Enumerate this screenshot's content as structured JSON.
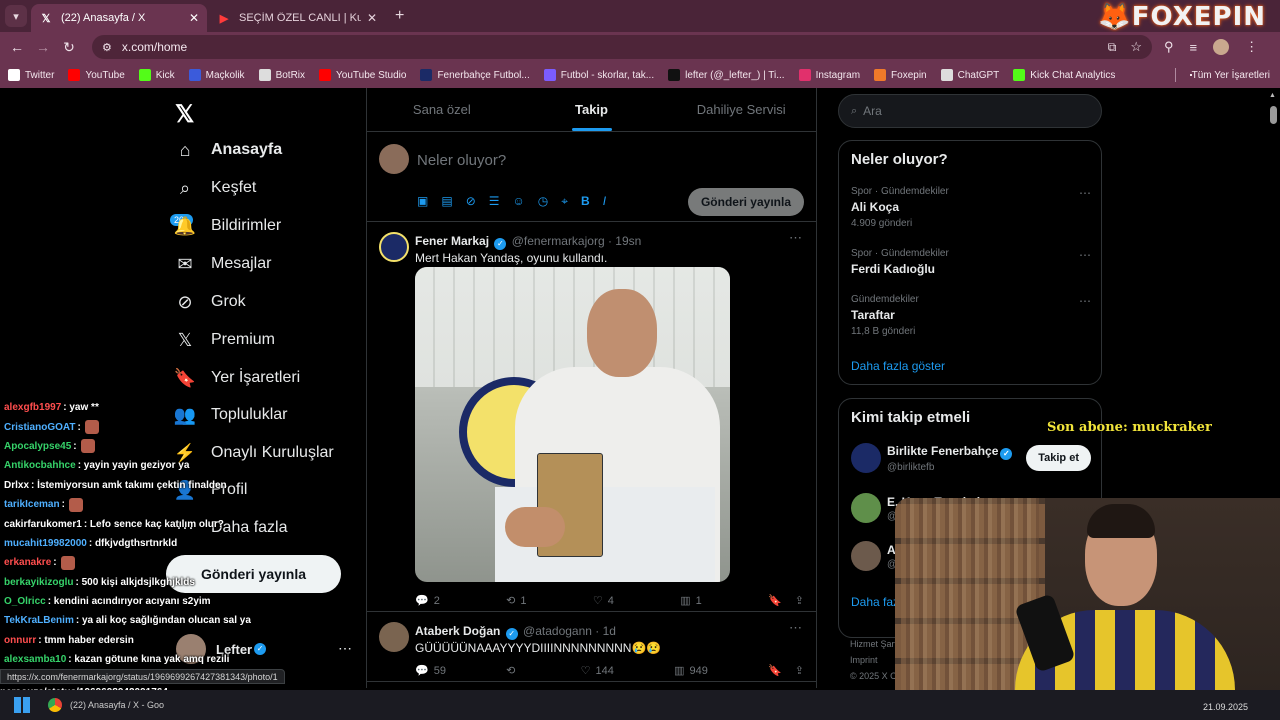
{
  "browser": {
    "tabs": [
      {
        "title": "(22) Anasayfa / X",
        "icon": "x-logo-icon"
      },
      {
        "title": "SEÇİM ÖZEL CANLI | Kulübü",
        "icon": "youtube-icon"
      }
    ],
    "url": "x.com/home",
    "brand": "FOXEPIN",
    "bookmarks": [
      {
        "label": "Twitter",
        "icon": "x-logo-icon",
        "color": "#ffffff"
      },
      {
        "label": "YouTube",
        "icon": "youtube-icon",
        "color": "#ff0000"
      },
      {
        "label": "Kick",
        "icon": "kick-icon",
        "color": "#53fc18"
      },
      {
        "label": "Maçkolik",
        "icon": "mackolik-icon",
        "color": "#3b5bdb"
      },
      {
        "label": "BotRix",
        "icon": "botrix-icon",
        "color": "#dddddd"
      },
      {
        "label": "YouTube Studio",
        "icon": "youtube-studio-icon",
        "color": "#ff0000"
      },
      {
        "label": "Fenerbahçe Futbol...",
        "icon": "fenerbahce-icon",
        "color": "#1b2a66"
      },
      {
        "label": "Futbol - skorlar, tak...",
        "icon": "futbol-icon",
        "color": "#7b5cff"
      },
      {
        "label": "lefter (@_lefter_) | Ti...",
        "icon": "tiktok-icon",
        "color": "#111111"
      },
      {
        "label": "Instagram",
        "icon": "instagram-icon",
        "color": "#e1306c"
      },
      {
        "label": "Foxepin",
        "icon": "foxepin-icon",
        "color": "#f07a2a"
      },
      {
        "label": "ChatGPT",
        "icon": "chatgpt-icon",
        "color": "#dddddd"
      },
      {
        "label": "Kick Chat Analytics",
        "icon": "kick-chat-icon",
        "color": "#53fc18"
      }
    ],
    "all_bookmarks": "Tüm Yer İşaretleri",
    "status_url": "https://x.com/fenermarkajorg/status/1969699267427381343/photo/1"
  },
  "x": {
    "nav": [
      {
        "label": "Anasayfa",
        "icon": "home-icon",
        "glyph": "⌂"
      },
      {
        "label": "Keşfet",
        "icon": "search-icon",
        "glyph": "⌕"
      },
      {
        "label": "Bildirimler",
        "icon": "bell-icon",
        "glyph": "🔔"
      },
      {
        "label": "Mesajlar",
        "icon": "mail-icon",
        "glyph": "✉"
      },
      {
        "label": "Grok",
        "icon": "grok-icon",
        "glyph": "⊘"
      },
      {
        "label": "Premium",
        "icon": "x-premium-icon",
        "glyph": "𝕏"
      },
      {
        "label": "Yer İşaretleri",
        "icon": "bookmark-icon",
        "glyph": "🔖"
      },
      {
        "label": "Topluluklar",
        "icon": "communities-icon",
        "glyph": "👥"
      },
      {
        "label": "Onaylı Kuruluşlar",
        "icon": "lightning-icon",
        "glyph": "⚡"
      },
      {
        "label": "Profil",
        "icon": "profile-icon",
        "glyph": "👤"
      },
      {
        "label": "Daha fazla",
        "icon": "more-icon",
        "glyph": "⋯"
      }
    ],
    "notif_badge": "20+",
    "post_button": "Gönderi yayınla",
    "profile_name": "Lefter",
    "feed_tabs": [
      "Sana özel",
      "Takip",
      "Dahiliye Servisi"
    ],
    "composer": {
      "placeholder": "Neler oluyor?",
      "post_button": "Gönderi yayınla"
    },
    "tweets": [
      {
        "name": "Fener Markaj",
        "handle": "@fenermarkajorg",
        "time": "· 19sn",
        "text": "Mert Hakan Yandaş, oyunu kullandı.",
        "replies": "2",
        "reposts": "1",
        "likes": "4",
        "views": "1"
      },
      {
        "name": "Ataberk Doğan",
        "handle": "@atadogann",
        "time": "· 1d",
        "text": "GÜÜÜÜÜNAAAYYYYDIIIINNNNNNNNN😢😢",
        "replies": "59",
        "reposts": "",
        "likes": "144",
        "views": "949"
      }
    ],
    "search_placeholder": "Ara",
    "trends_title": "Neler oluyor?",
    "trends": [
      {
        "category": "Spor · Gündemdekiler",
        "name": "Ali Koça",
        "count": "4.909 gönderi"
      },
      {
        "category": "Spor · Gündemdekiler",
        "name": "Ferdi Kadıoğlu",
        "count": ""
      },
      {
        "category": "Gündemdekiler",
        "name": "Taraftar",
        "count": "11,8 B gönderi"
      }
    ],
    "show_more": "Daha fazla göster",
    "who_title": "Kimi takip etmeli",
    "who": [
      {
        "name": "Birlikte Fenerbahçe",
        "handle": "@birliktefb",
        "button": "Takip et"
      },
      {
        "name": "E. Kaan Tanrıkulu",
        "handle": "@",
        "button": ""
      },
      {
        "name": "A",
        "handle": "@",
        "button": ""
      }
    ],
    "who_more": "Daha faz",
    "footer": [
      "Hizmet Şart",
      "Imprint",
      "© 2025 X C"
    ]
  },
  "stream": {
    "sub_banner": "Son abone: muckraker",
    "chat": [
      {
        "user": "alexgfb1997",
        "color": "#ff4e4e",
        "msg": " : yaw **"
      },
      {
        "user": "CristianoGOAT",
        "color": "#4fb0ff",
        "msg": " : "
      },
      {
        "user": "Apocalypse45",
        "color": "#36d36a",
        "msg": " : "
      },
      {
        "user": "Antikocbahhce",
        "color": "#36d36a",
        "msg": " : yayin yayin geziyor ya"
      },
      {
        "user": "Drlxx",
        "color": "#ffffff",
        "msg": " : İstemiyorsun amk takımı çektin finalden"
      },
      {
        "user": "tarikIceman",
        "color": "#4fb0ff",
        "msg": " : "
      },
      {
        "user": "cakirfarukomer1",
        "color": "#ffffff",
        "msg": " : Lefo sence kaç katılım olur?"
      },
      {
        "user": "mucahit19982000",
        "color": "#4fb0ff",
        "msg": " : dfkjvdgthsrtnrkld"
      },
      {
        "user": "erkanakre",
        "color": "#ff4e4e",
        "msg": " : "
      },
      {
        "user": "berkayikizoglu",
        "color": "#36d36a",
        "msg": " : 500 kişi alkjdsjlkghjklds"
      },
      {
        "user": "O_Olricc",
        "color": "#36d36a",
        "msg": " : kendini acındırıyor acıyanı s2yim"
      },
      {
        "user": "TekKraLBenim",
        "color": "#4fb0ff",
        "msg": " : ya ali koç sağlığından olucan sal ya"
      },
      {
        "user": "onnurr",
        "color": "#ff4e4e",
        "msg": " : tmm haber edersin"
      },
      {
        "user": "alexsamba10",
        "color": "#36d36a",
        "msg": " : kazan götune kına yak amq rezili"
      }
    ],
    "overlay_url": "nersouza/status/1969698942091764"
  },
  "taskbar": {
    "app": "(22) Anasayfa / X - Goo",
    "date": "21.09.2025"
  }
}
